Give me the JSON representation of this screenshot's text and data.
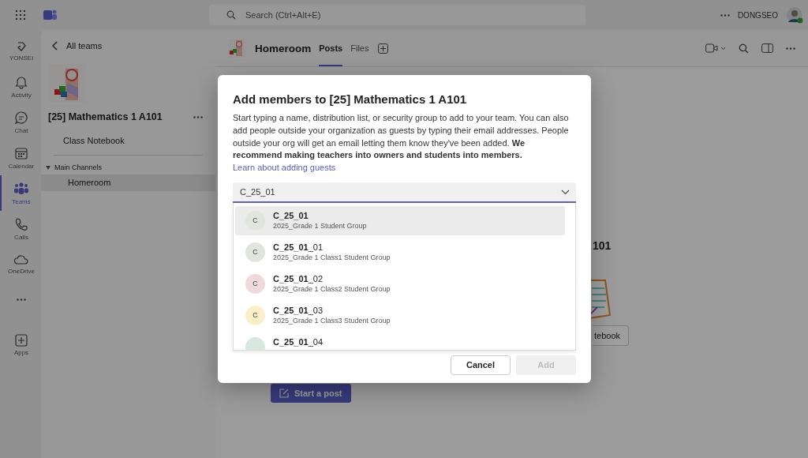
{
  "app_bar": {
    "search_placeholder": "Search (Ctrl+Alt+E)",
    "user_name": "DONGSEO"
  },
  "rail": [
    {
      "kind": "org",
      "label": "YONSEI",
      "selected": false
    },
    {
      "kind": "activity",
      "label": "Activity",
      "selected": false
    },
    {
      "kind": "chat",
      "label": "Chat",
      "selected": false
    },
    {
      "kind": "calendar",
      "label": "Calendar",
      "selected": false
    },
    {
      "kind": "teams",
      "label": "Teams",
      "selected": true
    },
    {
      "kind": "calls",
      "label": "Calls",
      "selected": false
    },
    {
      "kind": "onedrive",
      "label": "OneDrive",
      "selected": false
    },
    {
      "kind": "more",
      "selected": false
    },
    {
      "kind": "apps",
      "label": "Apps",
      "selected": false
    }
  ],
  "sidebar": {
    "back_link": "All teams",
    "team_name": "[25] Mathematics 1 A101",
    "class_notebook": "Class Notebook",
    "section": "Main Channels",
    "channels": [
      {
        "name": "Homeroom",
        "selected": true
      }
    ]
  },
  "channel_header": {
    "name": "Homeroom",
    "tabs": [
      {
        "label": "Posts",
        "selected": true
      },
      {
        "label": "Files",
        "selected": false
      }
    ]
  },
  "background": {
    "heading_fragment": "101",
    "button_fragment": "tebook",
    "start_post": "Start a post"
  },
  "dialog": {
    "title": "Add members to [25] Mathematics 1 A101",
    "description": "Start typing a name, distribution list, or security group to add to your team. You can also add people outside your organization as guests by typing their email addresses. People outside your org will get an email letting them know they've been added. **We recommend making teachers into owners and students into members.**",
    "link": "Learn about adding guests",
    "input_value": "C_25_01",
    "suggestions": [
      {
        "initial": "C",
        "name": "**C_25_01**",
        "subtitle": "2025_Grade 1 Student Group",
        "color": "#e1e6dc",
        "selected": true
      },
      {
        "initial": "C",
        "name": "**C_25_01**_01",
        "subtitle": "2025_Grade 1 Class1 Student Group",
        "color": "#e1e6dc",
        "selected": false
      },
      {
        "initial": "C",
        "name": "**C_25_01**_02",
        "subtitle": "2025_Grade 1 Class2 Student Group",
        "color": "#efd9dc",
        "selected": false
      },
      {
        "initial": "C",
        "name": "**C_25_01**_03",
        "subtitle": "2025_Grade 1 Class3 Student Group",
        "color": "#fbefc8",
        "selected": false
      },
      {
        "name": "**C_25_01**_04",
        "color": "#d6e8df",
        "selected": false
      }
    ],
    "buttons": [
      {
        "label": "Cancel",
        "kind": "secondary",
        "disabled": false
      },
      {
        "label": "Add",
        "kind": "primary",
        "disabled": true
      }
    ]
  }
}
